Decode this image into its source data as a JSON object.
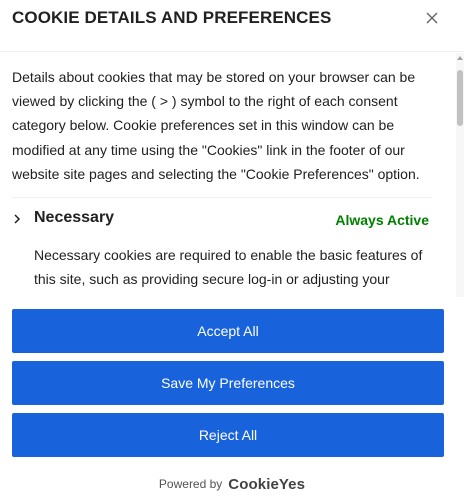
{
  "modal": {
    "title": "COOKIE DETAILS AND PREFERENCES",
    "close_icon": "close-icon"
  },
  "intro": {
    "text": "Details about cookies that may be stored on your browser can be viewed by clicking the ( > ) symbol to the right of each consent category below. Cookie preferences set in this window can be modified at any time using the \"Cookies\" link in the footer of our website site pages and selecting the \"Cookie Preferences\" option."
  },
  "categories": [
    {
      "title": "Necessary",
      "status": "Always Active",
      "description": "Necessary cookies are required to enable the basic features of this site, such as providing secure log-in or adjusting your",
      "icon": "chevron-right-icon"
    }
  ],
  "buttons": {
    "accept_all": "Accept All",
    "save_preferences": "Save My Preferences",
    "reject_all": "Reject All"
  },
  "footer": {
    "powered_by": "Powered by",
    "brand": "CookieYes"
  },
  "colors": {
    "accent": "#1863dc",
    "active": "#008000",
    "text": "#212121"
  }
}
